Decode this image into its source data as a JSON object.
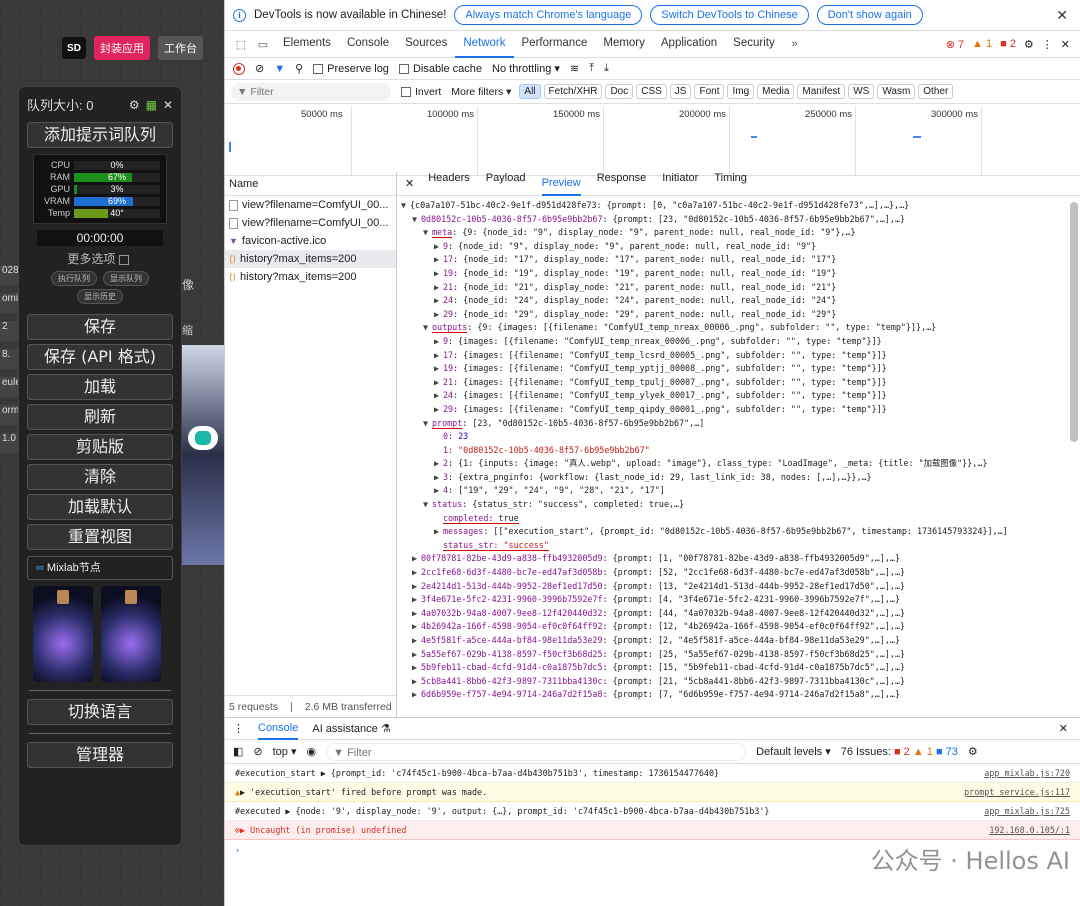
{
  "left": {
    "sd_logo": "SD",
    "package_btn": "封装应用",
    "workbench_btn": "工作台",
    "queue_size": "队列大小: 0",
    "add_prompt_queue": "添加提示词队列",
    "stats": [
      {
        "label": "CPU",
        "value": "0%",
        "color": "#2c7a2c",
        "fill": 0.0
      },
      {
        "label": "RAM",
        "value": "67%",
        "color": "#1d8f1d",
        "fill": 0.67
      },
      {
        "label": "GPU",
        "value": "3%",
        "color": "#1d8f1d",
        "fill": 0.03
      },
      {
        "label": "VRAM",
        "value": "69%",
        "color": "#1f6fd1",
        "fill": 0.69
      },
      {
        "label": "Temp",
        "value": "40°",
        "color": "#6a9a18",
        "fill": 0.4
      }
    ],
    "timer": "00:00:00",
    "more_options": "更多选项",
    "exec_queue": "执行队列",
    "show_queue": "显示队列",
    "show_history": "显示历史",
    "buttons": [
      "保存",
      "保存 (API 格式)",
      "加载",
      "刷新",
      "剪贴版",
      "清除",
      "加载默认",
      "重置视图"
    ],
    "mixlab": "Mixlab节点",
    "switch_lang": "切换语言",
    "manager": "管理器",
    "side_nodes": [
      "028",
      "omiz",
      "2",
      "8.",
      "eule",
      "orm",
      "1.0"
    ],
    "canvas_text_1": "像",
    "canvas_text_2": "缩"
  },
  "devtools": {
    "banner_text": "DevTools is now available in Chinese!",
    "banner_btn1": "Always match Chrome's language",
    "banner_btn2": "Switch DevTools to Chinese",
    "banner_btn3": "Don't show again",
    "tabs": [
      "Elements",
      "Console",
      "Sources",
      "Network",
      "Performance",
      "Memory",
      "Application",
      "Security"
    ],
    "selected_tab": "Network",
    "badges": {
      "errors": "7",
      "warnings": "1",
      "issues": "2"
    },
    "preserve_log": "Preserve log",
    "disable_cache": "Disable cache",
    "throttling": "No throttling",
    "filter_placeholder": "Filter",
    "invert": "Invert",
    "more_filters": "More filters",
    "filter_types": [
      "All",
      "Fetch/XHR",
      "Doc",
      "CSS",
      "JS",
      "Font",
      "Img",
      "Media",
      "Manifest",
      "WS",
      "Wasm",
      "Other"
    ],
    "overview_labels": [
      "50000 ms",
      "100000 ms",
      "150000 ms",
      "200000 ms",
      "250000 ms",
      "300000 ms"
    ],
    "name_header": "Name",
    "requests": [
      {
        "name": "view?filename=ComfyUI_00...",
        "kind": "doc"
      },
      {
        "name": "view?filename=ComfyUI_00...",
        "kind": "doc"
      },
      {
        "name": "favicon-active.ico",
        "kind": "ico"
      },
      {
        "name": "history?max_items=200",
        "kind": "xhr",
        "selected": true
      },
      {
        "name": "history?max_items=200",
        "kind": "xhr"
      }
    ],
    "req_count": "5 requests",
    "transferred": "2.6 MB transferred",
    "detail_tabs": [
      "Headers",
      "Payload",
      "Preview",
      "Response",
      "Initiator",
      "Timing"
    ],
    "detail_selected": "Preview",
    "preview_lines": [
      {
        "indent": 0,
        "tri": "▼",
        "text": "{c0a7a107-51bc-40c2-9e1f-d951d428fe73: {prompt: [0, \"c0a7a107-51bc-40c2-9e1f-d951d428fe73\",…],…},…}"
      },
      {
        "indent": 1,
        "tri": "▼",
        "key": "0d80152c-10b5-4036-8f57-6b95e9bb2b67",
        "text": ": {prompt: [23, \"0d80152c-10b5-4036-8f57-6b95e9bb2b67\",…],…}"
      },
      {
        "indent": 2,
        "tri": "▼",
        "key": "meta",
        "ul": true,
        "text": ": {9: {node_id: \"9\", display_node: \"9\", parent_node: null, real_node_id: \"9\"},…}"
      },
      {
        "indent": 3,
        "tri": "▶",
        "key": "9",
        "text": ": {node_id: \"9\", display_node: \"9\", parent_node: null, real_node_id: \"9\"}"
      },
      {
        "indent": 3,
        "tri": "▶",
        "key": "17",
        "text": ": {node_id: \"17\", display_node: \"17\", parent_node: null, real_node_id: \"17\"}"
      },
      {
        "indent": 3,
        "tri": "▶",
        "key": "19",
        "text": ": {node_id: \"19\", display_node: \"19\", parent_node: null, real_node_id: \"19\"}"
      },
      {
        "indent": 3,
        "tri": "▶",
        "key": "21",
        "text": ": {node_id: \"21\", display_node: \"21\", parent_node: null, real_node_id: \"21\"}"
      },
      {
        "indent": 3,
        "tri": "▶",
        "key": "24",
        "text": ": {node_id: \"24\", display_node: \"24\", parent_node: null, real_node_id: \"24\"}"
      },
      {
        "indent": 3,
        "tri": "▶",
        "key": "29",
        "text": ": {node_id: \"29\", display_node: \"29\", parent_node: null, real_node_id: \"29\"}"
      },
      {
        "indent": 2,
        "tri": "▼",
        "key": "outputs",
        "ul": true,
        "text": ": {9: {images: [{filename: \"ComfyUI_temp_nreax_00006_.png\", subfolder: \"\", type: \"temp\"}]},…}"
      },
      {
        "indent": 3,
        "tri": "▶",
        "key": "9",
        "text": ": {images: [{filename: \"ComfyUI_temp_nreax_00006_.png\", subfolder: \"\", type: \"temp\"}]}"
      },
      {
        "indent": 3,
        "tri": "▶",
        "key": "17",
        "text": ": {images: [{filename: \"ComfyUI_temp_lcsrd_00005_.png\", subfolder: \"\", type: \"temp\"}]}"
      },
      {
        "indent": 3,
        "tri": "▶",
        "key": "19",
        "text": ": {images: [{filename: \"ComfyUI_temp_yptjj_00008_.png\", subfolder: \"\", type: \"temp\"}]}"
      },
      {
        "indent": 3,
        "tri": "▶",
        "key": "21",
        "text": ": {images: [{filename: \"ComfyUI_temp_tpulj_00007_.png\", subfolder: \"\", type: \"temp\"}]}"
      },
      {
        "indent": 3,
        "tri": "▶",
        "key": "24",
        "text": ": {images: [{filename: \"ComfyUI_temp_ylyek_00017_.png\", subfolder: \"\", type: \"temp\"}]}"
      },
      {
        "indent": 3,
        "tri": "▶",
        "key": "29",
        "text": ": {images: [{filename: \"ComfyUI_temp_qipdy_00001_.png\", subfolder: \"\", type: \"temp\"}]}"
      },
      {
        "indent": 2,
        "tri": "▼",
        "key": "prompt",
        "ul": true,
        "text": ": [23, \"0d80152c-10b5-4036-8f57-6b95e9bb2b67\",…]"
      },
      {
        "indent": 3,
        "tri": "",
        "key": "0",
        "text": ": 23"
      },
      {
        "indent": 3,
        "tri": "",
        "key": "1",
        "text": ": \"0d80152c-10b5-4036-8f57-6b95e9bb2b67\""
      },
      {
        "indent": 3,
        "tri": "▶",
        "key": "2",
        "text": ": {1: {inputs: {image: \"真人.webp\", upload: \"image\"}, class_type: \"LoadImage\", _meta: {title: \"加载图像\"}},…}"
      },
      {
        "indent": 3,
        "tri": "▶",
        "key": "3",
        "text": ": {extra_pnginfo: {workflow: {last_node_id: 29, last_link_id: 38, nodes: [,…],…}},…}"
      },
      {
        "indent": 3,
        "tri": "▶",
        "key": "4",
        "text": ": [\"19\", \"29\", \"24\", \"9\", \"28\", \"21\", \"17\"]"
      },
      {
        "indent": 2,
        "tri": "▼",
        "key": "status",
        "text": ": {status_str: \"success\", completed: true,…}"
      },
      {
        "indent": 3,
        "tri": "",
        "key": "completed",
        "ul": true,
        "text": ": true"
      },
      {
        "indent": 3,
        "tri": "▶",
        "key": "messages",
        "text": ": [[\"execution_start\", {prompt_id: \"0d80152c-10b5-4036-8f57-6b95e9bb2b67\", timestamp: 1736145793324}],…]"
      },
      {
        "indent": 3,
        "tri": "",
        "key": "status_str",
        "ul": true,
        "text": ": \"success\""
      },
      {
        "indent": 1,
        "tri": "▶",
        "key": "00f78781-82be-43d9-a838-ffb4932005d9",
        "text": ": {prompt: [1, \"00f78781-82be-43d9-a838-ffb4932005d9\",…],…}"
      },
      {
        "indent": 1,
        "tri": "▶",
        "key": "2cc1fe68-6d3f-4480-bc7e-ed47af3d058b",
        "text": ": {prompt: [52, \"2cc1fe68-6d3f-4480-bc7e-ed47af3d058b\",…],…}"
      },
      {
        "indent": 1,
        "tri": "▶",
        "key": "2e4214d1-513d-444b-9952-28ef1ed17d50",
        "text": ": {prompt: [13, \"2e4214d1-513d-444b-9952-28ef1ed17d50\",…],…}"
      },
      {
        "indent": 1,
        "tri": "▶",
        "key": "3f4e671e-5fc2-4231-9960-3996b7592e7f",
        "text": ": {prompt: [4, \"3f4e671e-5fc2-4231-9960-3996b7592e7f\",…],…}"
      },
      {
        "indent": 1,
        "tri": "▶",
        "key": "4a07032b-94a8-4007-9ee8-12f420440d32",
        "text": ": {prompt: [44, \"4a07032b-94a8-4007-9ee8-12f420440d32\",…],…}"
      },
      {
        "indent": 1,
        "tri": "▶",
        "key": "4b26942a-166f-4598-9054-ef0c0f64ff92",
        "text": ": {prompt: [12, \"4b26942a-166f-4598-9054-ef0c0f64ff92\",…],…}"
      },
      {
        "indent": 1,
        "tri": "▶",
        "key": "4e5f581f-a5ce-444a-bf84-98e11da53e29",
        "text": ": {prompt: [2, \"4e5f581f-a5ce-444a-bf84-98e11da53e29\",…],…}"
      },
      {
        "indent": 1,
        "tri": "▶",
        "key": "5a55ef67-029b-4138-8597-f50cf3b68d25",
        "text": ": {prompt: [25, \"5a55ef67-029b-4138-8597-f50cf3b68d25\",…],…}"
      },
      {
        "indent": 1,
        "tri": "▶",
        "key": "5b9feb11-cbad-4cfd-91d4-c0a1875b7dc5",
        "text": ": {prompt: [15, \"5b9feb11-cbad-4cfd-91d4-c0a1875b7dc5\",…],…}"
      },
      {
        "indent": 1,
        "tri": "▶",
        "key": "5cb8a441-8bb6-42f3-9897-7311bba4130c",
        "text": ": {prompt: [21, \"5cb8a441-8bb6-42f3-9897-7311bba4130c\",…],…}"
      },
      {
        "indent": 1,
        "tri": "▶",
        "key": "6d6b959e-f757-4e94-9714-246a7d2f15a8",
        "text": ": {prompt: [7, \"6d6b959e-f757-4e94-9714-246a7d2f15a8\",…],…}"
      }
    ],
    "console_tab": "Console",
    "ai_tab": "AI assistance",
    "context": "top",
    "console_filter": "Filter",
    "default_levels": "Default levels",
    "issues_label": "76 Issues:",
    "issue_counts": {
      "err": "2",
      "warn": "1",
      "info": "73"
    },
    "console_lines": [
      {
        "kind": "log",
        "text": "#execution_start ▶ {prompt_id: 'c74f45c1-b900-4bca-b7aa-d4b430b751b3', timestamp: 1736154477640}",
        "src": "app_mixlab.js:720"
      },
      {
        "kind": "warn",
        "text": "▶ 'execution_start' fired before prompt was made.",
        "src": "prompt_service.js:117"
      },
      {
        "kind": "log",
        "text": "#executed ▶ {node: '9', display_node: '9', output: {…}, prompt_id: 'c74f45c1-b900-4bca-b7aa-d4b430b751b3'}",
        "src": "app_mixlab.js:725"
      },
      {
        "kind": "error",
        "text": "▶ Uncaught (in promise) undefined",
        "src": "192.168.0.105/:1"
      }
    ],
    "watermark": "公众号 · Hellos AI"
  }
}
